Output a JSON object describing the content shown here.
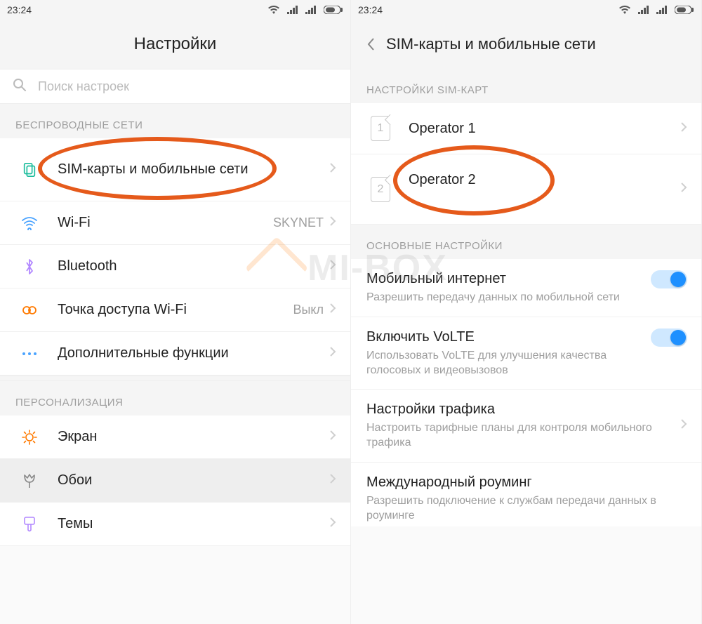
{
  "statusbar": {
    "time": "23:24"
  },
  "left": {
    "title": "Настройки",
    "search_placeholder": "Поиск настроек",
    "section_wireless": "БЕСПРОВОДНЫЕ СЕТИ",
    "sim_label": "SIM-карты и мобильные сети",
    "wifi_label": "Wi-Fi",
    "wifi_value": "SKYNET",
    "bt_label": "Bluetooth",
    "hotspot_label": "Точка доступа Wi-Fi",
    "hotspot_value": "Выкл",
    "more_label": "Дополнительные функции",
    "section_personal": "ПЕРСОНАЛИЗАЦИЯ",
    "display_label": "Экран",
    "wallpaper_label": "Обои",
    "themes_label": "Темы"
  },
  "right": {
    "title": "SIM-карты и мобильные сети",
    "section_sim": "НАСТРОЙКИ SIM-КАРТ",
    "sim1_num": "1",
    "sim1_label": "Operator 1",
    "sim2_num": "2",
    "sim2_label": "Operator 2",
    "section_main": "ОСНОВНЫЕ НАСТРОЙКИ",
    "mi_label": "Мобильный интернет",
    "mi_sub": "Разрешить передачу данных по мобильной сети",
    "volte_label": "Включить VoLTE",
    "volte_sub": "Использовать VoLTE для улучшения качества голосовых и видеовызовов",
    "traffic_label": "Настройки трафика",
    "traffic_sub": "Настроить тарифные планы для контроля мобильного трафика",
    "roam_label": "Международный роуминг",
    "roam_sub": "Разрешить подключение к службам передачи данных в роуминге"
  },
  "watermark": "MI-BOX"
}
